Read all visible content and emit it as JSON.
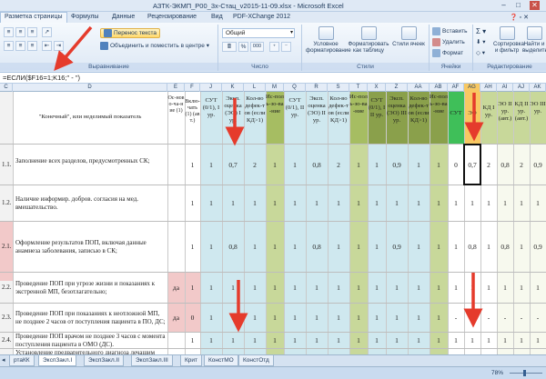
{
  "window": {
    "title": "АЗТК-ЭКМП_P00_3х-Стац_v2015-11-09.xlsx - Microsoft Excel"
  },
  "tabs": [
    "Разметка страницы",
    "Формулы",
    "Данные",
    "Рецензирование",
    "Вид",
    "PDF-XChange 2012"
  ],
  "ribbon": {
    "alignment": {
      "label": "Выравнивание",
      "wrap_text": "Перенос текста",
      "merge_center": "Объединить и поместить в центре"
    },
    "number": {
      "label": "Число",
      "format": "Общий",
      "percent": "%",
      "thousands": "000"
    },
    "styles": {
      "label": "Стили",
      "conditional": "Условное форматирование",
      "format_table": "Форматировать как таблицу",
      "cell_styles": "Стили ячеек"
    },
    "cells": {
      "label": "Ячейки",
      "insert": "Вставить",
      "delete": "Удалить",
      "format": "Формат"
    },
    "editing": {
      "label": "Редактирование",
      "sort": "Сортировка и фильтр",
      "find": "Найти и выделить"
    }
  },
  "formula": "=ЕСЛИ($F16=1;K16;\" - \")",
  "columns": [
    "C",
    "D",
    "E",
    "F",
    "J",
    "K",
    "L",
    "M",
    "Q",
    "R",
    "S",
    "T",
    "X",
    "Z",
    "AA",
    "AB",
    "AF",
    "AG",
    "AH",
    "AI",
    "AJ",
    "AK",
    "AL"
  ],
  "header_row": {
    "d": "\"Конечный\", или неделимый показатель",
    "e": "Ос-ново-ча-ние (1)",
    "f": "Вклю-чать (1) (авт.)",
    "j": "СУТ (0/1), I ур.",
    "k": "Эксп. оценка (ЭО) I ур.",
    "l": "Кол-во дефек-тов (если КД>1)",
    "m": "Ис-поль-зо-ва-ние",
    "q": "СУТ (0/1), II ур.",
    "r": "Эксп. оценка (ЭО) II ур.",
    "s": "Кол-во дефек-тов (если КД>1)",
    "t": "Ис-поль-зо-ва-ние",
    "x": "СУТ (0/1), III ур.",
    "z": "Эксп. оценка (ЭО) III ур.",
    "aa": "Кол-во дефек-тов (если КД>1)",
    "ab": "Ис-поль-зо-ва-ние",
    "af": "СУТ",
    "ag": "ЭО",
    "ah": "КД I ур.",
    "ai": "ЭО II ур. (авт.)",
    "aj": "КД II ур. (авт.)",
    "ak": "ЭО III ур.",
    "al": ""
  },
  "rows": [
    {
      "num": "1.1.",
      "text": "Заполнение всех разделов, предусмотренных СК;",
      "e": "",
      "f": "1",
      "j": "1",
      "k": "0,7",
      "l": "2",
      "m": "1",
      "q": "1",
      "r": "0,8",
      "s": "2",
      "t": "1",
      "x": "1",
      "z": "0,9",
      "aa": "1",
      "ab": "1",
      "af": "0",
      "ag": "0,7",
      "ah": "2",
      "ai": "0,8",
      "aj": "2",
      "ak": "0,9",
      "al": "1"
    },
    {
      "num": "1.2.",
      "text": "Наличие информир. добров. согласия на мед. вмешательство.",
      "e": "",
      "f": "1",
      "j": "1",
      "k": "1",
      "l": "1",
      "m": "1",
      "q": "1",
      "r": "1",
      "s": "1",
      "t": "1",
      "x": "1",
      "z": "1",
      "aa": "1",
      "ab": "1",
      "af": "1",
      "ag": "1",
      "ah": "1",
      "ai": "1",
      "aj": "1",
      "ak": "1",
      "al": "1"
    },
    {
      "num": "2.1.",
      "text": "Оформление результатов ПОП, включая данные анамнеза заболевания, записью в СК;",
      "e": "",
      "f": "1",
      "j": "1",
      "k": "0,8",
      "l": "1",
      "m": "1",
      "q": "1",
      "r": "0,8",
      "s": "1",
      "t": "1",
      "x": "1",
      "z": "0,9",
      "aa": "1",
      "ab": "1",
      "af": "1",
      "ag": "0,8",
      "ah": "1",
      "ai": "0,8",
      "aj": "1",
      "ak": "0,9",
      "al": "1"
    },
    {
      "num": "2.2.",
      "text": "Проведение ПОП при угрозе жизни и показаниях к экстренной МП, безотлагательно;",
      "e": "да",
      "f": "1",
      "j": "1",
      "k": "1",
      "l": "1",
      "m": "1",
      "q": "1",
      "r": "1",
      "s": "1",
      "t": "1",
      "x": "1",
      "z": "1",
      "aa": "1",
      "ab": "1",
      "af": "1",
      "ag": "1",
      "ah": "1",
      "ai": "1",
      "aj": "1",
      "ak": "1",
      "al": "1"
    },
    {
      "num": "2.3.",
      "text": "Проведение ПОП при показаниях к неотложной МП, не позднее 2 часов от поступления пациента в ПО, ДС;",
      "e": "да",
      "f": "0",
      "j": "1",
      "k": "1",
      "l": "1",
      "m": "1",
      "q": "1",
      "r": "1",
      "s": "1",
      "t": "1",
      "x": "1",
      "z": "1",
      "aa": "1",
      "ab": "1",
      "af": "-",
      "ag": "-",
      "ah": "-",
      "ai": "-",
      "aj": "-",
      "ak": "-",
      "al": "-"
    },
    {
      "num": "2.4.",
      "text": "Проведение ПОП врачом не позднее 3 часов с момента поступления пациента в ОМО (ДС).",
      "e": "",
      "f": "1",
      "j": "1",
      "k": "1",
      "l": "1",
      "m": "1",
      "q": "1",
      "r": "1",
      "s": "1",
      "t": "1",
      "x": "1",
      "z": "1",
      "aa": "1",
      "ab": "1",
      "af": "1",
      "ag": "1",
      "ah": "1",
      "ai": "1",
      "aj": "1",
      "ak": "1",
      "al": "1"
    },
    {
      "num": "",
      "text": "Установление предварительного диагноза лечащим",
      "e": "",
      "f": "",
      "j": "",
      "k": "",
      "l": "",
      "m": "",
      "q": "",
      "r": "",
      "s": "",
      "t": "",
      "x": "",
      "z": "",
      "aa": "",
      "ab": "",
      "af": "",
      "ag": "",
      "ah": "",
      "ai": "",
      "aj": "",
      "ak": "",
      "al": ""
    }
  ],
  "sheets": [
    "ртаКК",
    "ЭкспЗакл.I",
    "ЭкспЗакл.II",
    "ЭкспЗакл.III",
    "Крит",
    "КонстМО",
    "КонстОтд"
  ],
  "active_sheet": "ЭкспЗакл.I",
  "zoom": "78%",
  "colors": {
    "accent": "#f8c862",
    "light_blue": "#cfe8ef",
    "olive": "#c8d89a",
    "dark_olive": "#8aa04b",
    "green": "#3fbf59",
    "pink": "#f2c9c9",
    "selection": "#f8c862"
  }
}
